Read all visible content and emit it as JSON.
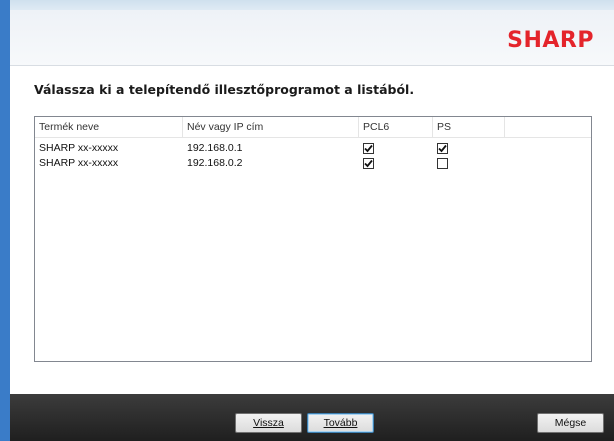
{
  "header": {
    "brand": "SHARP"
  },
  "instruction": "Válassza ki a telepítendő illesztőprogramot a listából.",
  "table": {
    "columns": [
      "Termék neve",
      "Név vagy IP cím",
      "PCL6",
      "PS"
    ],
    "rows": [
      {
        "product": "SHARP xx-xxxxx",
        "address": "192.168.0.1",
        "pcl6": true,
        "ps": true
      },
      {
        "product": "SHARP xx-xxxxx",
        "address": "192.168.0.2",
        "pcl6": true,
        "ps": false
      }
    ]
  },
  "buttons": {
    "back": {
      "label": "Vissza"
    },
    "next": {
      "label": "Tovább"
    },
    "cancel": {
      "label": "Mégse"
    }
  },
  "colors": {
    "brand": "#e4242b",
    "footer": "#2a2a2a",
    "accent": "#3a7cc8"
  }
}
